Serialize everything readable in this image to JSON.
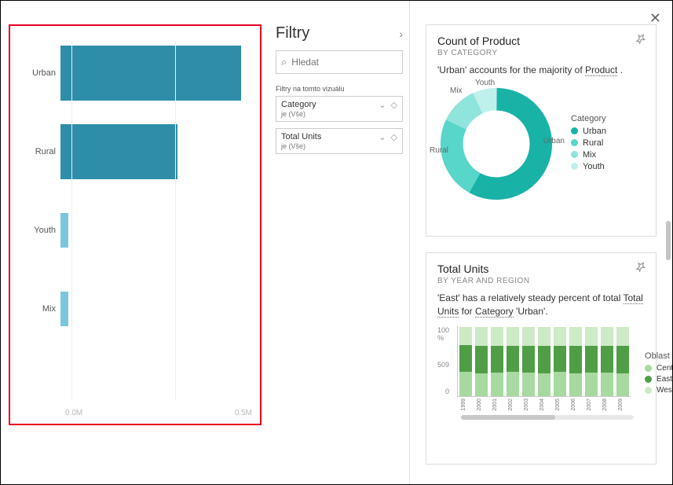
{
  "close_label": "✕",
  "filters": {
    "title": "Filtry",
    "search_placeholder": "Hledat",
    "section_label": "Filtry na tomto vizuálu",
    "items": [
      {
        "name": "Category",
        "value": "je (Vše)"
      },
      {
        "name": "Total Units",
        "value": "je (Vše)"
      }
    ]
  },
  "cards": {
    "donut": {
      "title": "Count of Product",
      "subtitle": "BY CATEGORY",
      "insight_pre": "'Urban' accounts for the majority of ",
      "insight_link": "Product",
      "insight_post": " .",
      "legend_title": "Category"
    },
    "stacked": {
      "title": "Total Units",
      "subtitle": "BY YEAR AND REGION",
      "insight_p1a": "'East' has a relatively steady percent of total ",
      "insight_p1b": "Total Units",
      "insight_p2a": " for ",
      "insight_p2b": "Category",
      "insight_p2c": " 'Urban'.",
      "legend_title": "Oblast",
      "yticks": {
        "top": "100 %",
        "mid": "509",
        "bot": "0"
      }
    }
  },
  "chart_data": [
    {
      "type": "bar",
      "orientation": "horizontal",
      "categories": [
        "Urban",
        "Rural",
        "Youth",
        "Mix"
      ],
      "values": [
        0.48,
        0.31,
        0.02,
        0.02
      ],
      "xlim": [
        0,
        0.5
      ],
      "xticks": [
        "0.0M",
        "0.5M"
      ],
      "colors": [
        "#2e8ea9",
        "#2e8ea9",
        "#7bc6dd",
        "#7bc6dd"
      ]
    },
    {
      "type": "pie",
      "variant": "donut",
      "title": "Count of Product by Category",
      "series": [
        {
          "name": "Urban",
          "value": 58,
          "color": "#18b3a6"
        },
        {
          "name": "Rural",
          "value": 24,
          "color": "#57d6c9"
        },
        {
          "name": "Mix",
          "value": 11,
          "color": "#8fe4db"
        },
        {
          "name": "Youth",
          "value": 7,
          "color": "#c0f0eb"
        }
      ]
    },
    {
      "type": "bar",
      "variant": "stacked-100",
      "title": "Total Units by Year and Region",
      "categories": [
        "1999",
        "2000",
        "2001",
        "2002",
        "2003",
        "2004",
        "2005",
        "2006",
        "2007",
        "2008",
        "2009"
      ],
      "series": [
        {
          "name": "Central",
          "color": "#a7d9a0",
          "values": [
            35,
            33,
            34,
            35,
            34,
            33,
            35,
            33,
            34,
            34,
            33
          ]
        },
        {
          "name": "East",
          "color": "#4f9e46",
          "values": [
            38,
            39,
            38,
            37,
            38,
            39,
            37,
            39,
            38,
            38,
            39
          ]
        },
        {
          "name": "West",
          "color": "#cdeac6",
          "values": [
            27,
            28,
            28,
            28,
            28,
            28,
            28,
            28,
            28,
            28,
            28
          ]
        }
      ],
      "ylim": [
        0,
        100
      ],
      "ylabel": "%"
    }
  ]
}
